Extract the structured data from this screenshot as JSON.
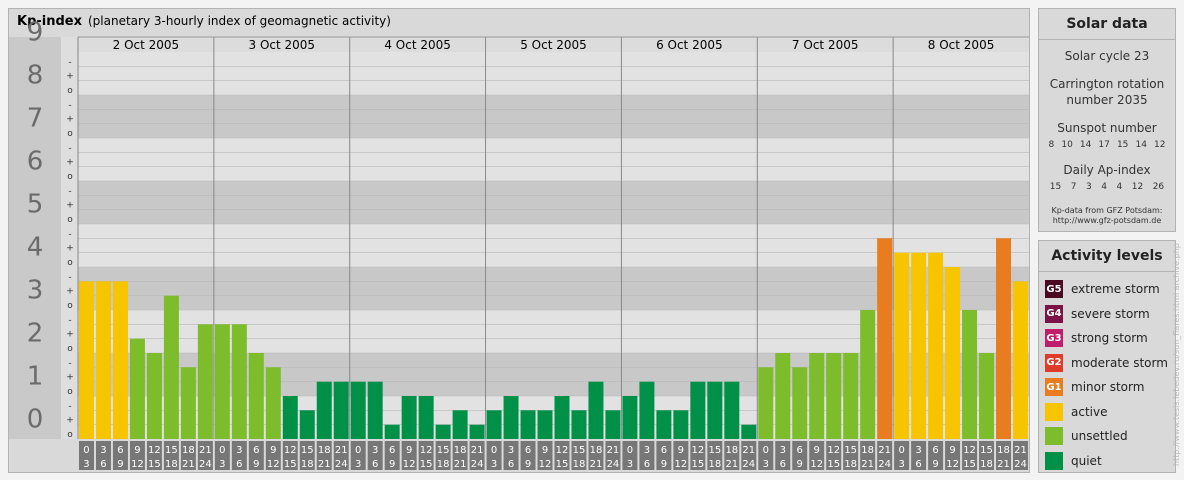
{
  "title": "Kp-index",
  "subtitle": "(planetary 3-hourly index of geomagnetic activity)",
  "solar": {
    "title": "Solar data",
    "cycle": "Solar cycle 23",
    "carrington_1": "Carrington rotation",
    "carrington_2": "number 2035",
    "sunspot_label": "Sunspot number",
    "sunspot_values": [
      "8",
      "10",
      "14",
      "17",
      "15",
      "14",
      "12"
    ],
    "ap_label": "Daily Ap-index",
    "ap_values": [
      "15",
      "7",
      "3",
      "4",
      "4",
      "12",
      "26"
    ],
    "credit_1": "Kp-data from GFZ Potsdam:",
    "credit_2": "http://www.gfz-potsdam.de"
  },
  "activity": {
    "title": "Activity levels",
    "levels": [
      {
        "code": "G5",
        "label": "extreme storm",
        "color": "#4a0a22"
      },
      {
        "code": "G4",
        "label": "severe storm",
        "color": "#7a1446"
      },
      {
        "code": "G3",
        "label": "strong storm",
        "color": "#bf1f6a"
      },
      {
        "code": "G2",
        "label": "moderate storm",
        "color": "#dc3c28"
      },
      {
        "code": "G1",
        "label": "minor storm",
        "color": "#e87c1e"
      },
      {
        "code": "",
        "label": "active",
        "color": "#f6c500"
      },
      {
        "code": "",
        "label": "unsettled",
        "color": "#7dbc2a"
      },
      {
        "code": "",
        "label": "quiet",
        "color": "#009048"
      }
    ]
  },
  "watermark": "http://www.tesis.lebedev.ru/sun_flares.html  archive.php",
  "chart_data": {
    "type": "bar",
    "ylim": [
      0,
      9
    ],
    "y_ticks": [
      "0",
      "1",
      "2",
      "3",
      "4",
      "5",
      "6",
      "7",
      "8",
      "9"
    ],
    "minor_marks": [
      "o",
      "+",
      "-"
    ],
    "days": [
      "2 Oct 2005",
      "3 Oct 2005",
      "4 Oct 2005",
      "5 Oct 2005",
      "6 Oct 2005",
      "7 Oct 2005",
      "8 Oct 2005"
    ],
    "interval_top": [
      "0",
      "3",
      "6",
      "9",
      "12",
      "15",
      "18",
      "21"
    ],
    "interval_bottom": [
      "3",
      "6",
      "9",
      "12",
      "15",
      "18",
      "21",
      "24"
    ],
    "values": [
      3.667,
      3.667,
      3.667,
      2.333,
      2.0,
      3.333,
      1.667,
      2.667,
      2.667,
      2.667,
      2.0,
      1.667,
      1.0,
      0.667,
      1.333,
      1.333,
      1.333,
      1.333,
      0.333,
      1.0,
      1.0,
      0.333,
      0.667,
      0.333,
      0.667,
      1.0,
      0.667,
      0.667,
      1.0,
      0.667,
      1.333,
      0.667,
      1.0,
      1.333,
      0.667,
      0.667,
      1.333,
      1.333,
      1.333,
      0.333,
      1.667,
      2.0,
      1.667,
      2.0,
      2.0,
      2.0,
      3.0,
      4.667,
      4.333,
      4.333,
      4.333,
      4.0,
      3.0,
      2.0,
      4.667,
      3.667
    ],
    "colors": {
      "quiet": "#009048",
      "unsettled": "#7dbc2a",
      "active": "#f6c500",
      "minor_storm": "#e87c1e"
    },
    "grid": true
  }
}
